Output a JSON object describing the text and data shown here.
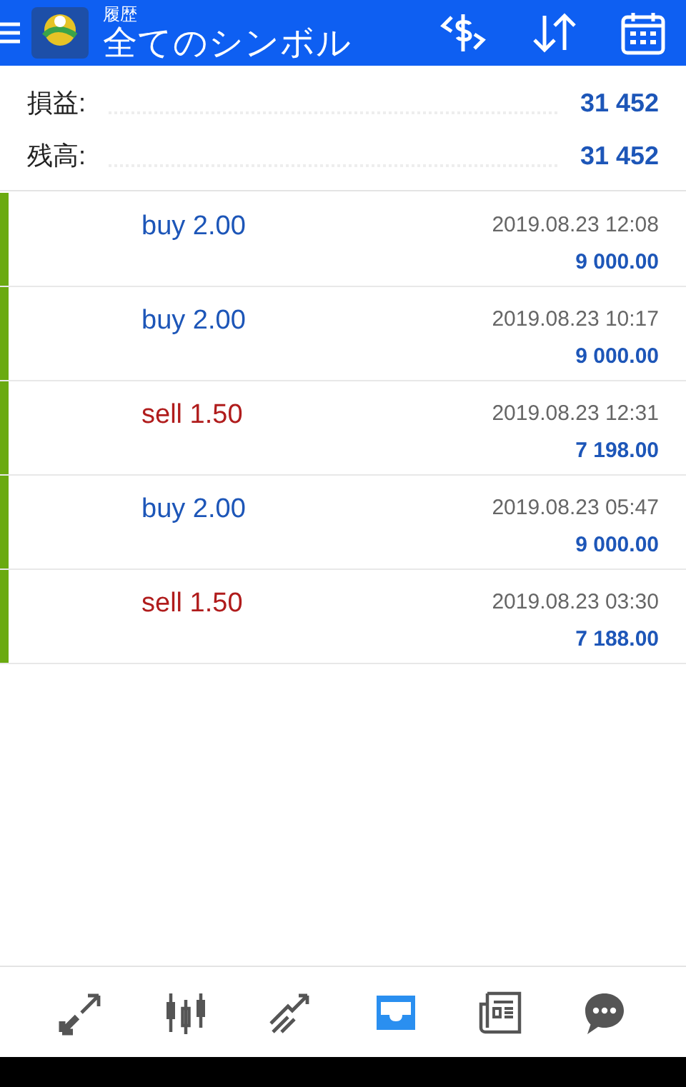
{
  "header": {
    "subtitle": "履歴",
    "title": "全てのシンボル"
  },
  "summary": [
    {
      "label": "損益:",
      "value": "31 452"
    },
    {
      "label": "残高:",
      "value": "31 452"
    }
  ],
  "deals": [
    {
      "kind": "buy",
      "type": "buy 2.00",
      "time": "2019.08.23 12:08",
      "amount": "9 000.00"
    },
    {
      "kind": "buy",
      "type": "buy 2.00",
      "time": "2019.08.23 10:17",
      "amount": "9 000.00"
    },
    {
      "kind": "sell",
      "type": "sell 1.50",
      "time": "2019.08.23 12:31",
      "amount": "7 198.00"
    },
    {
      "kind": "buy",
      "type": "buy 2.00",
      "time": "2019.08.23 05:47",
      "amount": "9 000.00"
    },
    {
      "kind": "sell",
      "type": "sell 1.50",
      "time": "2019.08.23 03:30",
      "amount": "7 188.00"
    }
  ],
  "nav": [
    {
      "kind": "quotes",
      "selected": false
    },
    {
      "kind": "chart",
      "selected": false
    },
    {
      "kind": "trade",
      "selected": false
    },
    {
      "kind": "history",
      "selected": true
    },
    {
      "kind": "news",
      "selected": false
    },
    {
      "kind": "chat",
      "selected": false
    }
  ]
}
